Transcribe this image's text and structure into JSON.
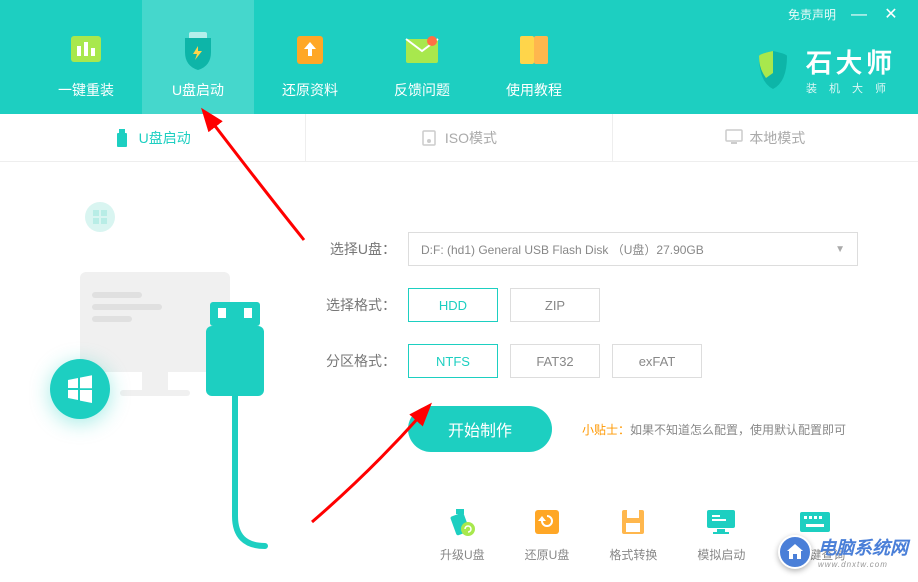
{
  "titlebar": {
    "disclaimer": "免责声明"
  },
  "nav": {
    "items": [
      {
        "label": "一键重装"
      },
      {
        "label": "U盘启动"
      },
      {
        "label": "还原资料"
      },
      {
        "label": "反馈问题"
      },
      {
        "label": "使用教程"
      }
    ]
  },
  "brand": {
    "name": "石大师",
    "subtitle": "装机大师"
  },
  "subtabs": {
    "usb": "U盘启动",
    "iso": "ISO模式",
    "local": "本地模式"
  },
  "form": {
    "select_usb_label": "选择U盘：",
    "select_usb_value": "D:F: (hd1) General USB Flash Disk （U盘）27.90GB",
    "select_fmt_label": "选择格式：",
    "fmt_options": [
      "HDD",
      "ZIP"
    ],
    "partition_label": "分区格式：",
    "partition_options": [
      "NTFS",
      "FAT32",
      "exFAT"
    ]
  },
  "action": {
    "main_button": "开始制作",
    "tip_label": "小贴士：",
    "tip_text": "如果不知道怎么配置，使用默认配置即可"
  },
  "tools": [
    {
      "label": "升级U盘"
    },
    {
      "label": "还原U盘"
    },
    {
      "label": "格式转换"
    },
    {
      "label": "模拟启动"
    },
    {
      "label": "快捷键查询"
    }
  ],
  "watermark": {
    "title": "电脑系统网",
    "url": "www.dnxtw.com"
  }
}
